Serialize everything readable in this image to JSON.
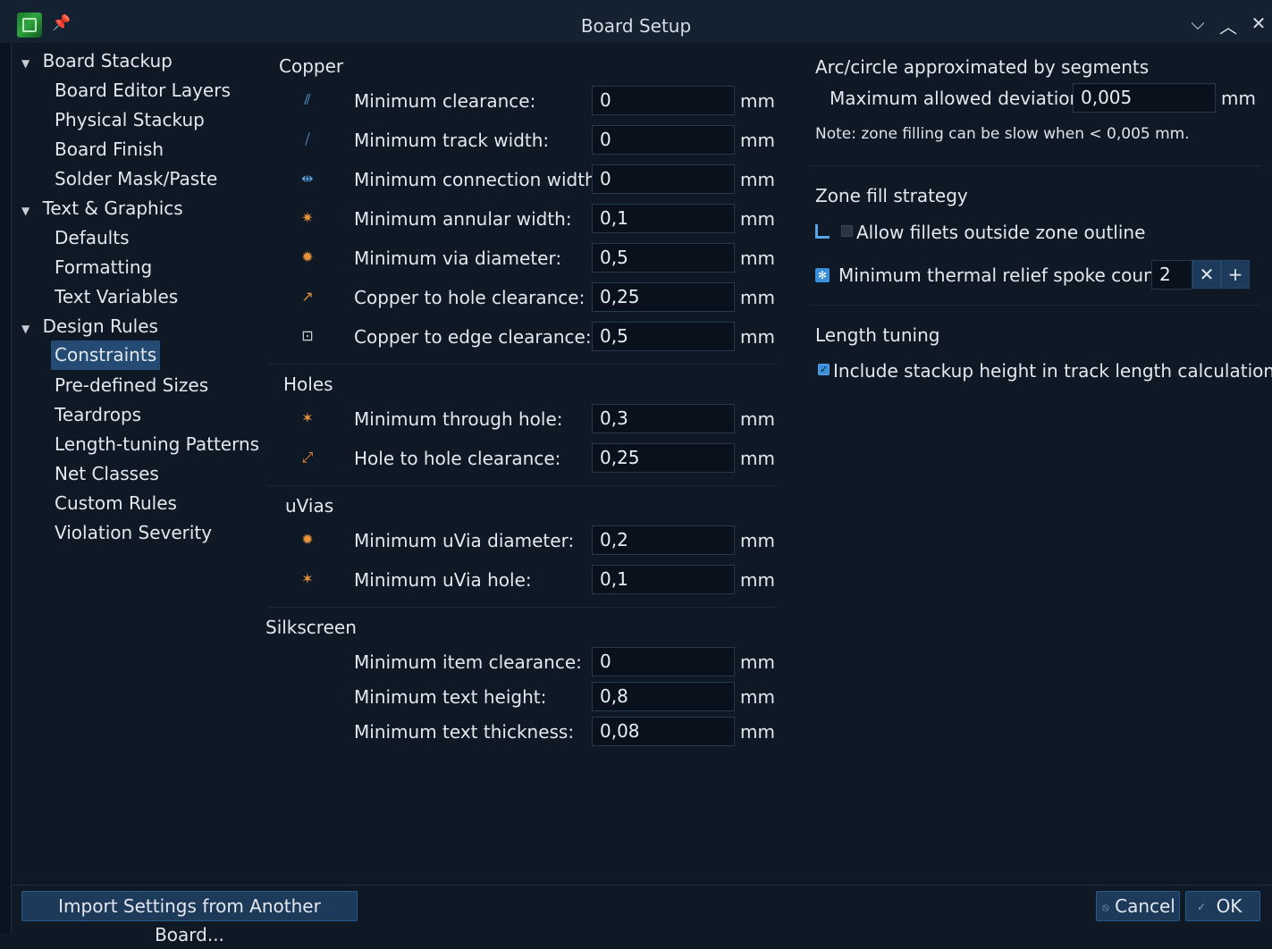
{
  "window": {
    "title": "Board Setup",
    "pin_icon": "pin-icon",
    "minimize_glyph": "⌵",
    "maximize_glyph": "︿",
    "close_glyph": "✕"
  },
  "tree": {
    "groups": [
      {
        "label": "Board Stackup",
        "children": [
          "Board Editor Layers",
          "Physical Stackup",
          "Board Finish",
          "Solder Mask/Paste"
        ]
      },
      {
        "label": "Text & Graphics",
        "children": [
          "Defaults",
          "Formatting",
          "Text Variables"
        ]
      },
      {
        "label": "Design Rules",
        "children": [
          "Constraints",
          "Pre-defined Sizes",
          "Teardrops",
          "Length-tuning Patterns",
          "Net Classes",
          "Custom Rules",
          "Violation Severity"
        ]
      }
    ],
    "selected": "Constraints"
  },
  "copper": {
    "title": "Copper",
    "rows": [
      {
        "label": "Minimum clearance:",
        "value": "0",
        "unit": "mm"
      },
      {
        "label": "Minimum track width:",
        "value": "0",
        "unit": "mm"
      },
      {
        "label": "Minimum connection width:",
        "value": "0",
        "unit": "mm"
      },
      {
        "label": "Minimum annular width:",
        "value": "0,1",
        "unit": "mm"
      },
      {
        "label": "Minimum via diameter:",
        "value": "0,5",
        "unit": "mm"
      },
      {
        "label": "Copper to hole clearance:",
        "value": "0,25",
        "unit": "mm"
      },
      {
        "label": "Copper to edge clearance:",
        "value": "0,5",
        "unit": "mm"
      }
    ]
  },
  "holes": {
    "title": "Holes",
    "rows": [
      {
        "label": "Minimum through hole:",
        "value": "0,3",
        "unit": "mm"
      },
      {
        "label": "Hole to hole clearance:",
        "value": "0,25",
        "unit": "mm"
      }
    ]
  },
  "uvias": {
    "title": "uVias",
    "rows": [
      {
        "label": "Minimum uVia diameter:",
        "value": "0,2",
        "unit": "mm"
      },
      {
        "label": "Minimum uVia hole:",
        "value": "0,1",
        "unit": "mm"
      }
    ]
  },
  "silkscreen": {
    "title": "Silkscreen",
    "rows": [
      {
        "label": "Minimum item clearance:",
        "value": "0",
        "unit": "mm"
      },
      {
        "label": "Minimum text height:",
        "value": "0,8",
        "unit": "mm"
      },
      {
        "label": "Minimum text thickness:",
        "value": "0,08",
        "unit": "mm"
      }
    ]
  },
  "arc": {
    "title": "Arc/circle approximated by segments",
    "deviation_label": "Maximum allowed deviation:",
    "deviation_value": "0,005",
    "deviation_unit": "mm",
    "note": "Note: zone filling can be slow when < 0,005 mm."
  },
  "zone": {
    "title": "Zone fill strategy",
    "fillets_label": "Allow fillets outside zone outline",
    "fillets_checked": false,
    "spoke_label": "Minimum thermal relief spoke count:",
    "spoke_value": "2",
    "minus_glyph": "✕",
    "plus_glyph": "+"
  },
  "length": {
    "title": "Length tuning",
    "stackup_label": "Include stackup height in track length calculations",
    "stackup_checked": true
  },
  "buttons": {
    "import": "Import Settings from Another Board...",
    "cancel": "Cancel",
    "ok": "OK"
  },
  "colors": {
    "accent": "#244b73",
    "icon_orange": "#e8923a",
    "icon_blue": "#5aa5e8"
  }
}
